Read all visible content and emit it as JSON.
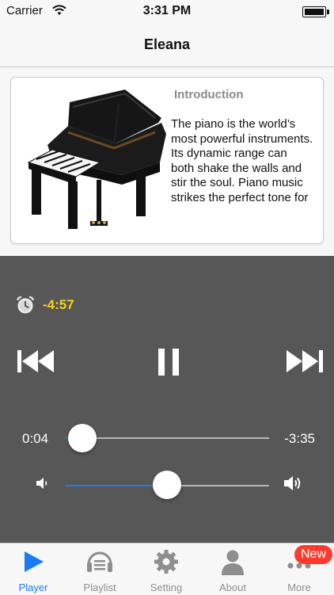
{
  "status_bar": {
    "carrier": "Carrier",
    "time": "3:31 PM"
  },
  "nav": {
    "title": "Eleana"
  },
  "intro": {
    "heading": "Introduction",
    "body": "The piano is the world’s most powerful instruments. Its dynamic range can both shake the walls and stir the soul. Piano music strikes the perfect tone for"
  },
  "player": {
    "sleep_timer": "-4:57",
    "elapsed": "0:04",
    "remaining": "-3:35",
    "progress_fraction": 0.02,
    "volume_fraction": 0.48
  },
  "tabs": [
    {
      "label": "Player",
      "icon": "play-icon",
      "active": true
    },
    {
      "label": "Playlist",
      "icon": "playlist-icon",
      "active": false
    },
    {
      "label": "Setting",
      "icon": "gear-icon",
      "active": false
    },
    {
      "label": "About",
      "icon": "person-icon",
      "active": false
    },
    {
      "label": "More",
      "icon": "more-icon",
      "active": false
    }
  ],
  "badge": {
    "text": "New"
  },
  "colors": {
    "accent": "#1a7cf5",
    "timer": "#f2d31b",
    "player_bg": "#575757",
    "badge": "#ff3b30"
  }
}
